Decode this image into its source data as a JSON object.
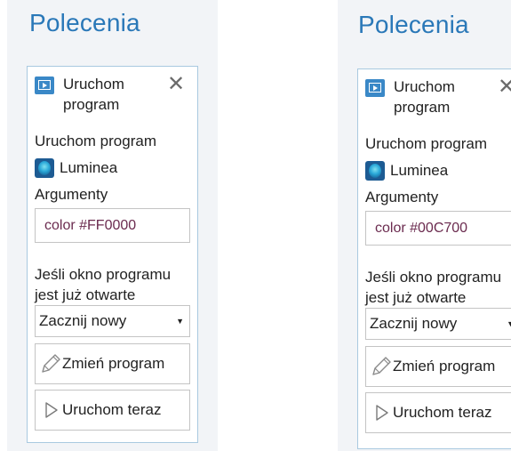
{
  "panels": [
    {
      "heading": "Polecenia",
      "card_title": "Uruchom program",
      "close_glyph": "✕",
      "program_label": "Uruchom program",
      "app_name": "Luminea",
      "args_label": "Argumenty",
      "args_value": "color #FF0000",
      "if_open_label": "Jeśli okno programu jest już otwarte",
      "if_open_selected": "Zacznij nowy",
      "change_program_label": "Zmień program",
      "run_now_label": "Uruchom teraz"
    },
    {
      "heading": "Polecenia",
      "card_title": "Uruchom program",
      "close_glyph": "✕",
      "program_label": "Uruchom program",
      "app_name": "Luminea",
      "args_label": "Argumenty",
      "args_value": "color #00C700",
      "if_open_label": "Jeśli okno programu jest już otwarte",
      "if_open_selected": "Zacznij nowy",
      "change_program_label": "Zmień program",
      "run_now_label": "Uruchom teraz"
    }
  ],
  "icons": {
    "card": "run-program-icon",
    "close": "close-icon",
    "app": "luminea-app-icon",
    "dropdown": "chevron-down-icon",
    "change": "pencil-icon",
    "run": "play-icon"
  },
  "colors": {
    "heading": "#2a78b8",
    "card_border": "#a9c9e0",
    "icon_blue": "#3a88c7",
    "field_text": "#6b2b4f"
  }
}
